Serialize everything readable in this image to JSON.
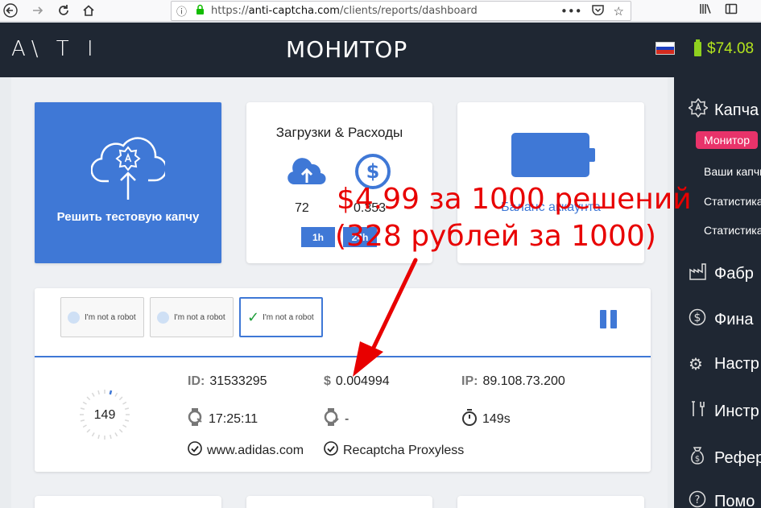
{
  "browser": {
    "url_prefix": "https://",
    "url_host": "anti-captcha.com",
    "url_path": "/clients/reports/dashboard",
    "back_icon": "arrow-left-icon",
    "forward_icon": "arrow-right-icon",
    "reload_icon": "reload-icon",
    "home_icon": "home-icon"
  },
  "header": {
    "logo": "A\\ T I",
    "title": "МОНИТОР",
    "balance": "$74.08",
    "accent_color": "#8fd11f"
  },
  "cards": {
    "solve_label": "Решить тестовую капчу",
    "upload_title": "Загрузки & Расходы",
    "upload_count": "72",
    "spend_amount": "0.353",
    "tab_1h": "1h",
    "tab_24h": "24h",
    "balance_label": "Баланс аккаунта"
  },
  "captcha_options": [
    {
      "label": "I'm not a robot",
      "selected": false
    },
    {
      "label": "I'm not a robot",
      "selected": false
    },
    {
      "label": "I'm not a robot",
      "selected": true
    }
  ],
  "task": {
    "timer": "149",
    "id_label": "ID:",
    "id_value": "31533295",
    "price_label": "$",
    "price_value": "0.004994",
    "ip_label": "IP:",
    "ip_value": "89.108.73.200",
    "time_value": "17:25:11",
    "time_end_value": "-",
    "duration_value": "149s",
    "domain_value": "www.adidas.com",
    "type_value": "Recaptcha Proxyless"
  },
  "sidebar": {
    "items": [
      {
        "label": "Капча",
        "icon": "captcha-icon"
      },
      {
        "label": "Фабр",
        "icon": "factory-icon"
      },
      {
        "label": "Фина",
        "icon": "dollar-icon"
      },
      {
        "label": "Настр",
        "icon": "gear-icon"
      },
      {
        "label": "Инстр",
        "icon": "tools-icon"
      },
      {
        "label": "Рефер",
        "icon": "referral-icon"
      },
      {
        "label": "Помо",
        "icon": "help-icon"
      }
    ],
    "subitems": [
      "Монитор",
      "Ваши капчи",
      "Статистика",
      "Статистика"
    ]
  },
  "annotation": {
    "line1": "$4.99 за 1000 решений",
    "line2": "(328 рублей за 1000)",
    "color": "#e80000"
  }
}
